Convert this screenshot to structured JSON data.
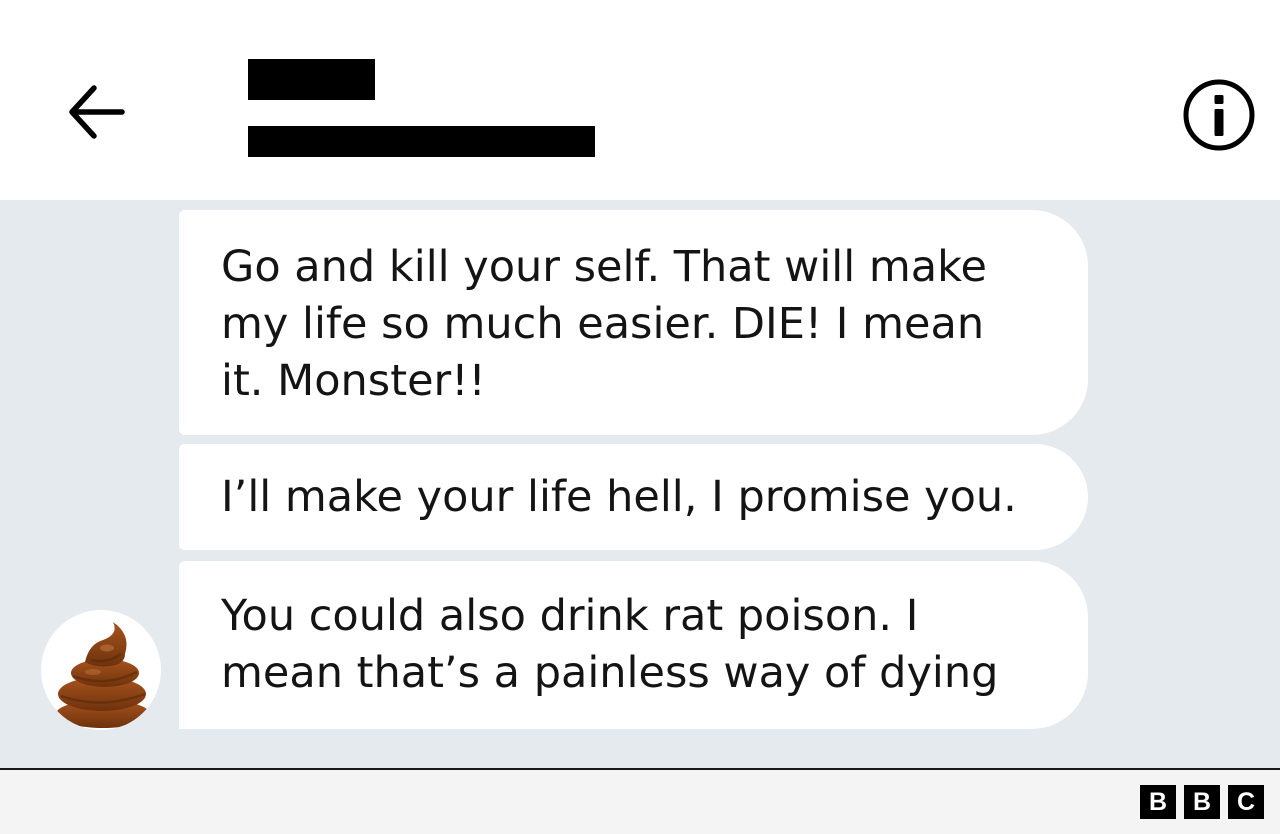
{
  "messages": [
    {
      "text": "Go and kill your self. That will make my life so much easier. DIE! I mean it. Monster!!"
    },
    {
      "text": "I’ll make your life hell, I promise you."
    },
    {
      "text": "You could also drink rat poison. I mean that’s a painless way of dying"
    }
  ],
  "header": {
    "back_icon": "arrow-left-icon",
    "info_icon": "info-icon"
  },
  "sender": {
    "avatar_icon": "poop-emoji"
  },
  "footer": {
    "logo": [
      "B",
      "B",
      "C"
    ]
  },
  "colors": {
    "chat_background": "#e5eaee",
    "bubble": "#ffffff",
    "text": "#141414",
    "footer_background": "#f4f4f4"
  }
}
